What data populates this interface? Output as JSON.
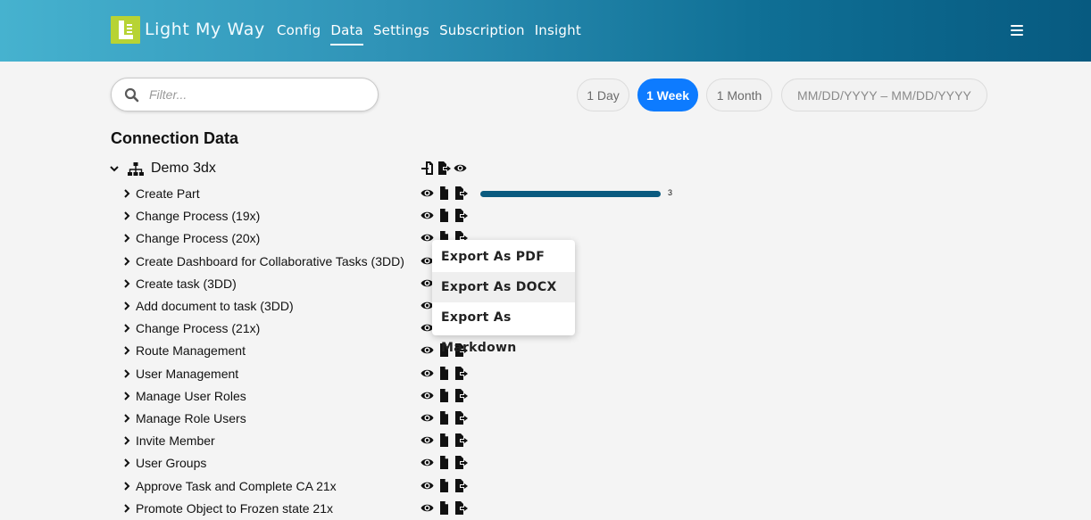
{
  "app": {
    "brand": "Light My Way"
  },
  "nav": {
    "items": [
      "Config",
      "Data",
      "Settings",
      "Subscription",
      "Insight"
    ],
    "active": "Data"
  },
  "filter": {
    "placeholder": "Filter..."
  },
  "ranges": {
    "day": "1 Day",
    "week": "1 Week",
    "month": "1 Month",
    "active": "1 Week",
    "date_placeholder": "MM/DD/YYYY – MM/DD/YYYY"
  },
  "section": {
    "title": "Connection Data"
  },
  "root": {
    "label": "Demo 3dx"
  },
  "rows": [
    {
      "label": "Create Part",
      "count": "3"
    },
    {
      "label": "Change Process (19x)"
    },
    {
      "label": "Change Process (20x)"
    },
    {
      "label": "Create Dashboard for Collaborative Tasks (3DD)"
    },
    {
      "label": "Create task (3DD)"
    },
    {
      "label": "Add document to task (3DD)"
    },
    {
      "label": "Change Process (21x)"
    },
    {
      "label": "Route Management"
    },
    {
      "label": "User Management"
    },
    {
      "label": "Manage User Roles"
    },
    {
      "label": "Manage Role Users"
    },
    {
      "label": "Invite Member"
    },
    {
      "label": "User Groups"
    },
    {
      "label": "Approve Task and Complete CA 21x"
    },
    {
      "label": "Promote Object to Frozen state 21x"
    }
  ],
  "progress": {
    "create_part": 1.0
  },
  "export_menu": {
    "pdf": "Export As PDF",
    "docx": "Export As DOCX",
    "markdown": "Export As Markdown",
    "highlighted": "Export As DOCX"
  },
  "colors": {
    "accent": "#0d7bff",
    "bar": "#0a5a7f",
    "logo": "#b7d334",
    "header_start": "#46b2cf",
    "header_end": "#075a80"
  },
  "icons": {
    "root_actions": [
      "file-import-icon",
      "file-export-icon",
      "eye-icon"
    ],
    "row_actions": [
      "eye-icon",
      "file-icon",
      "file-export-icon"
    ],
    "search": "search-icon",
    "menu": "hamburger-icon",
    "tree": "sitemap-icon"
  }
}
